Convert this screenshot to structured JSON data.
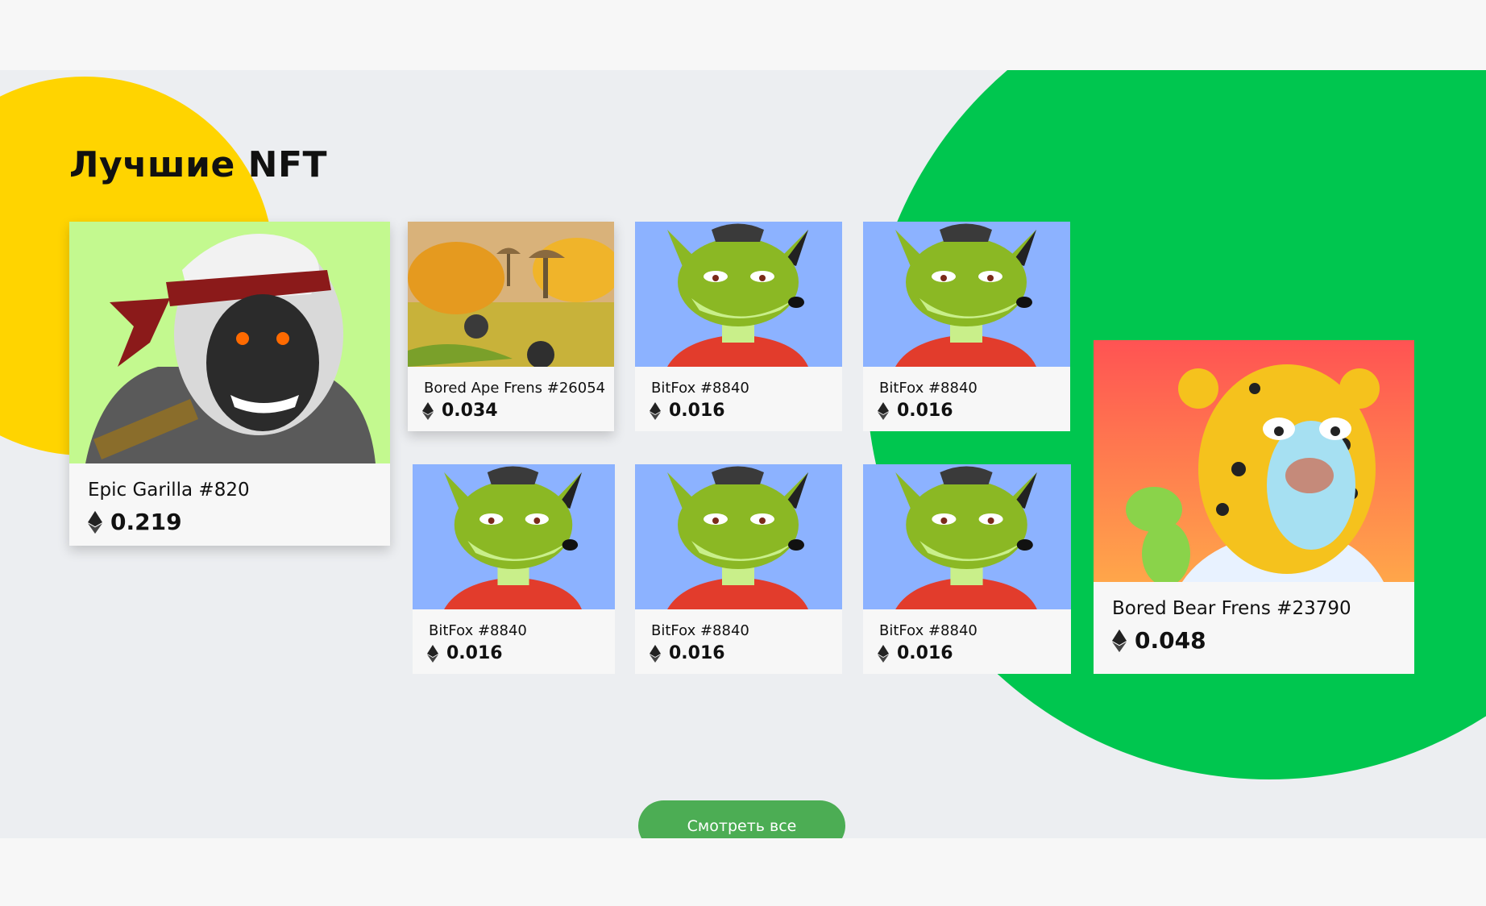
{
  "section": {
    "title": "Лучшие NFT",
    "view_all_label": "Смотреть все"
  },
  "colors": {
    "yellow_circle": "#ffd400",
    "green_circle": "#00c64f",
    "button": "#4cad54",
    "section_bg": "#eceef1"
  },
  "currency_icon": "ethereum-icon",
  "cards": [
    {
      "name": "Epic Garilla #820",
      "price": "0.219",
      "art": "gorilla"
    },
    {
      "name": "Bored Ape Frens #26054",
      "price": "0.034",
      "art": "mushroom-landscape"
    },
    {
      "name": "BitFox #8840",
      "price": "0.016",
      "art": "fox"
    },
    {
      "name": "BitFox #8840",
      "price": "0.016",
      "art": "fox"
    },
    {
      "name": "BitFox #8840",
      "price": "0.016",
      "art": "fox"
    },
    {
      "name": "BitFox #8840",
      "price": "0.016",
      "art": "fox"
    },
    {
      "name": "BitFox #8840",
      "price": "0.016",
      "art": "fox"
    },
    {
      "name": "Bored Bear Frens #23790",
      "price": "0.048",
      "art": "leopard-bear"
    }
  ]
}
